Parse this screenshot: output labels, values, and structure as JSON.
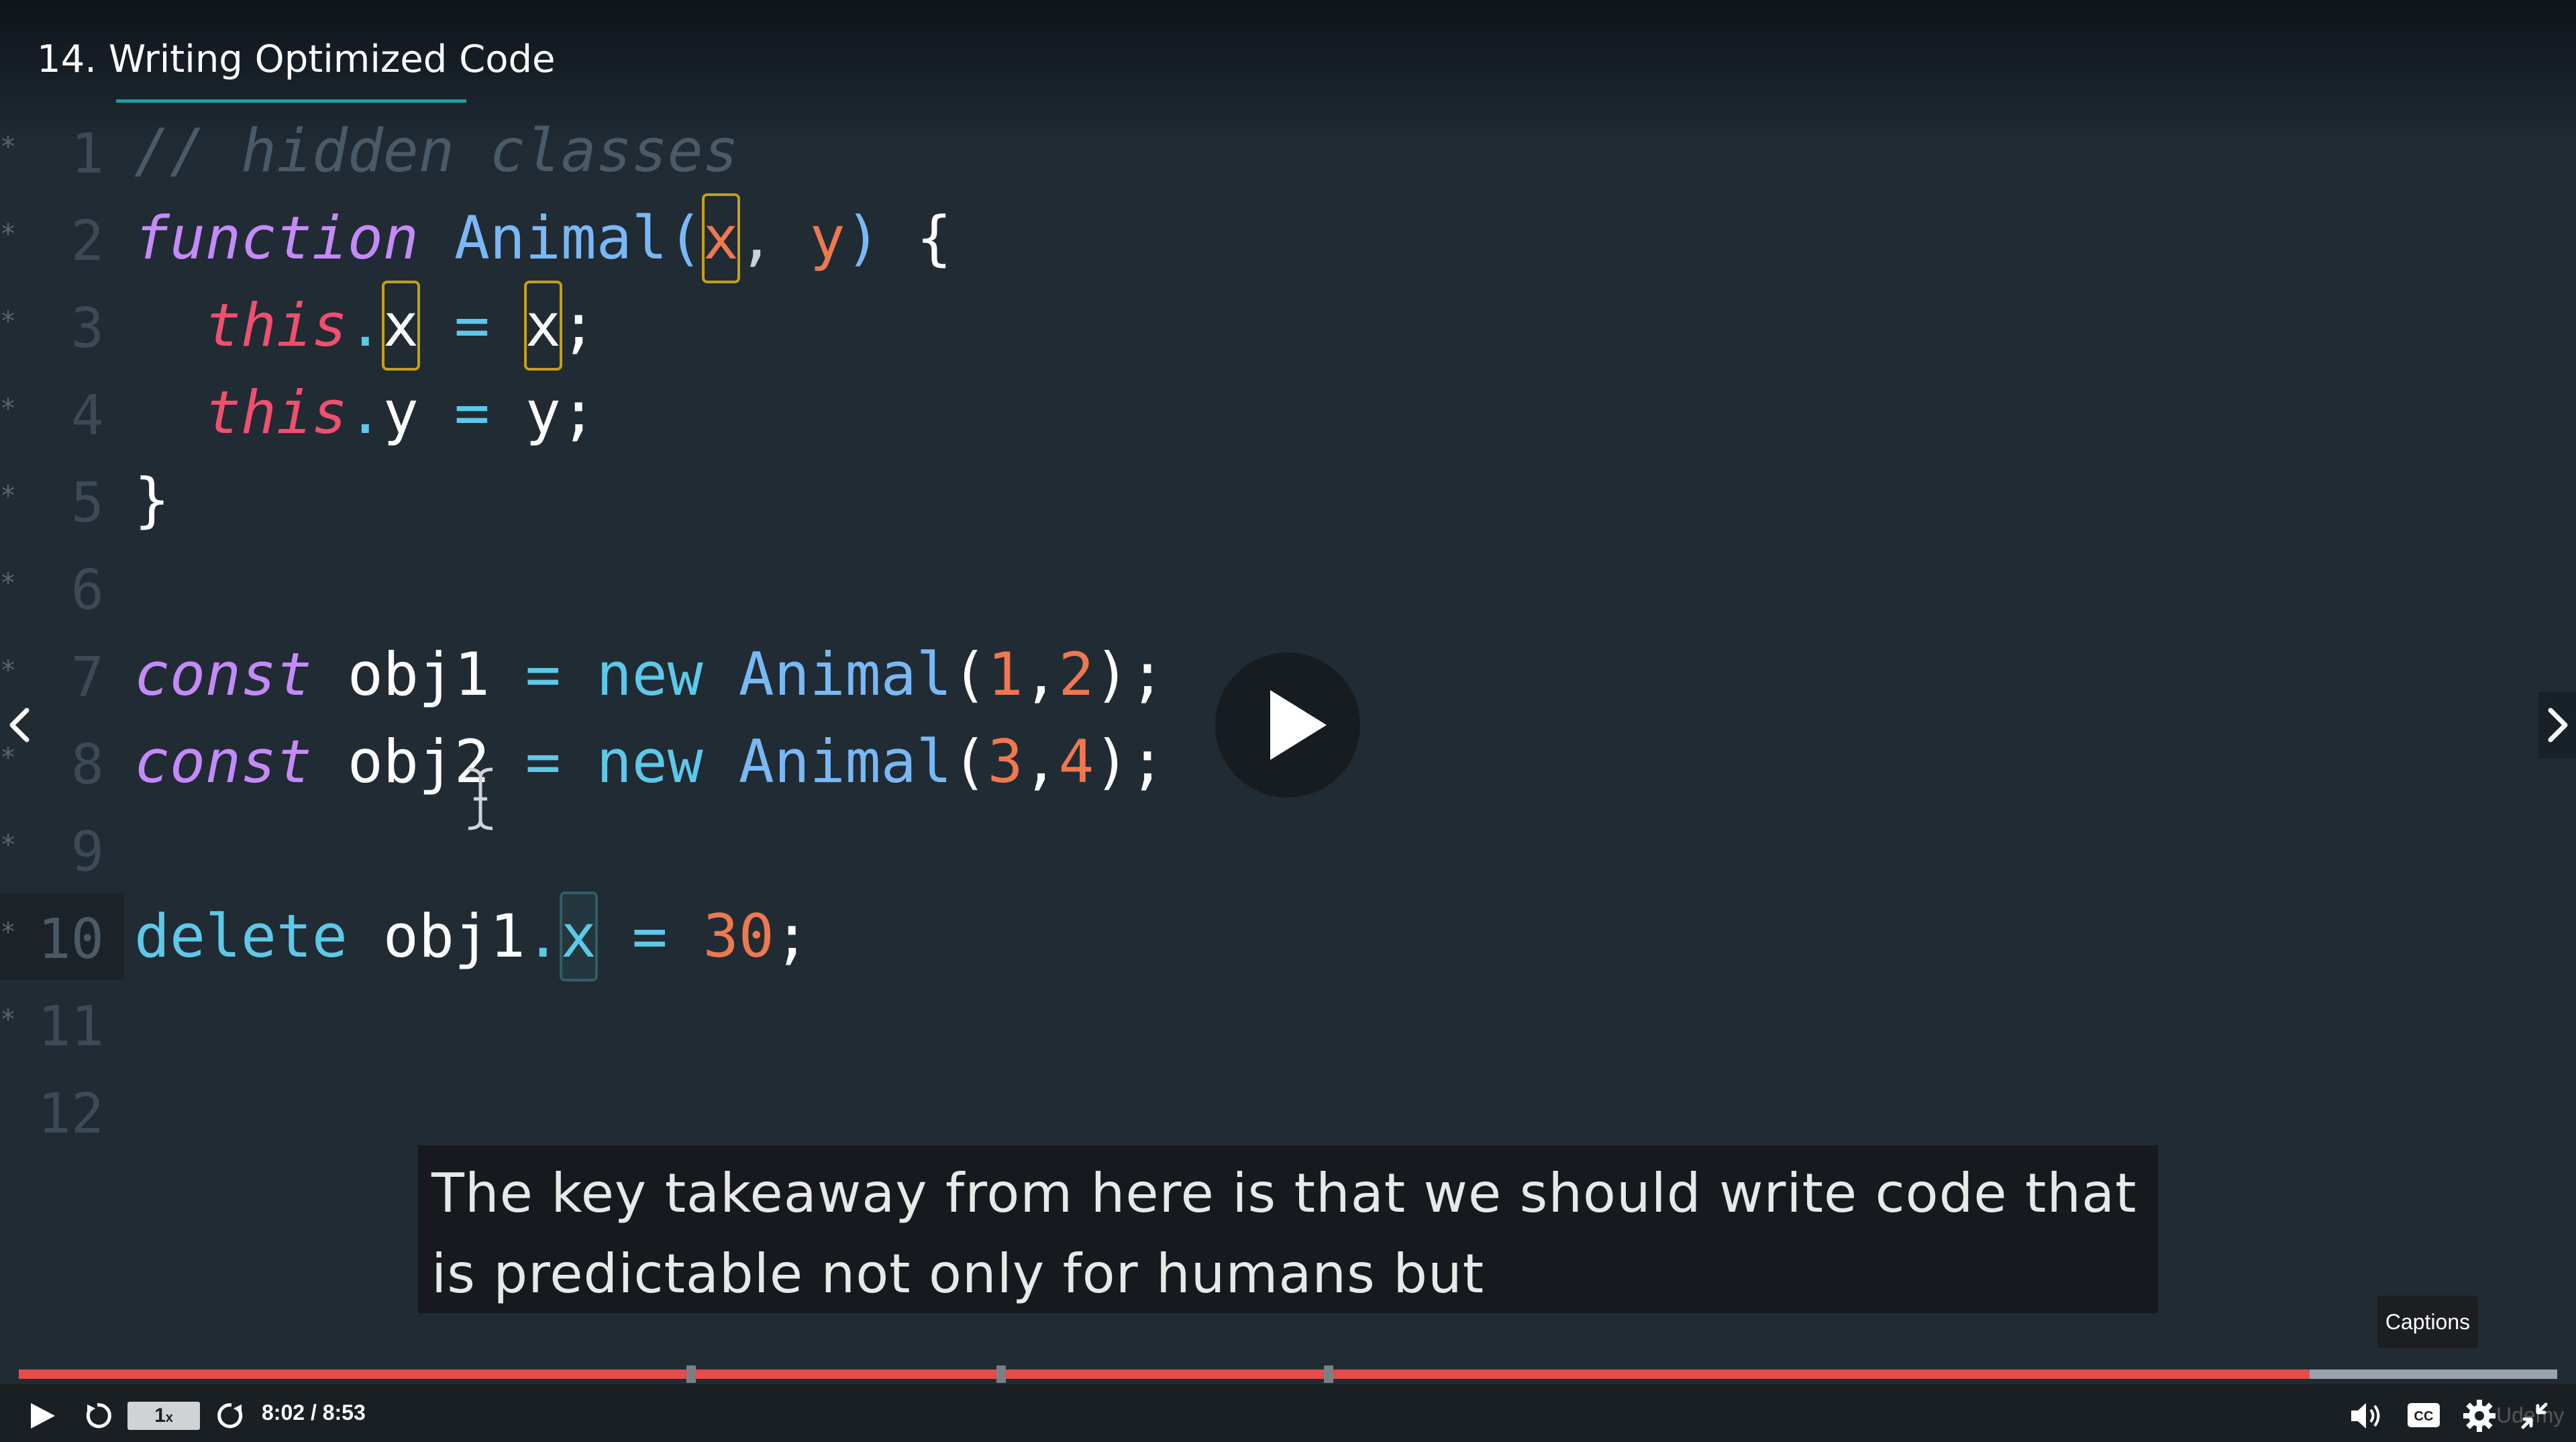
{
  "header": {
    "title": "14. Writing Optimized Code"
  },
  "editor": {
    "lines": [
      {
        "number": "1",
        "marker": "*"
      },
      {
        "number": "2",
        "marker": "*"
      },
      {
        "number": "3",
        "marker": "*"
      },
      {
        "number": "4",
        "marker": "*"
      },
      {
        "number": "5",
        "marker": "*"
      },
      {
        "number": "6",
        "marker": "*"
      },
      {
        "number": "7",
        "marker": "*"
      },
      {
        "number": "8",
        "marker": "*"
      },
      {
        "number": "9",
        "marker": "*"
      },
      {
        "number": "10",
        "marker": "*"
      },
      {
        "number": "11",
        "marker": "*"
      },
      {
        "number": "12",
        "marker": ""
      }
    ],
    "code": {
      "l1": {
        "comment": "// hidden classes"
      },
      "l2": {
        "kw": "function",
        "sp1": " ",
        "name": "Animal",
        "p1": "(",
        "a": "x",
        "comma": ", ",
        "b": "y",
        "p2": ")",
        "sp2": " ",
        "brace": "{"
      },
      "l3": {
        "indent": "  ",
        "this": "this",
        "dot": ".",
        "prop": "x",
        "eq": " = ",
        "val": "x",
        "semi": ";"
      },
      "l4": {
        "indent": "  ",
        "this": "this",
        "dot": ".",
        "prop": "y",
        "eq": " = ",
        "val": "y",
        "semi": ";"
      },
      "l5": {
        "brace": "}"
      },
      "l7": {
        "kw": "const",
        "sp": " ",
        "var": "obj1",
        "eq": " = ",
        "new": "new",
        "sp2": " ",
        "cls": "Animal",
        "p1": "(",
        "n1": "1",
        "comma": ",",
        "n2": "2",
        "p2": ")",
        "semi": ";"
      },
      "l8": {
        "kw": "const",
        "sp": " ",
        "var": "obj2",
        "eq": " = ",
        "new": "new",
        "sp2": " ",
        "cls": "Animal",
        "p1": "(",
        "n1": "3",
        "comma": ",",
        "n2": "4",
        "p2": ")",
        "semi": ";"
      },
      "l10": {
        "kw": "delete",
        "sp": " ",
        "obj": "obj1",
        "dot": ".",
        "prop": "x",
        "eq": " = ",
        "num": "30",
        "semi": ";"
      }
    }
  },
  "captions": {
    "text": "The key takeaway from here is that we should write code that is predictable not only for humans but",
    "tooltip": "Captions"
  },
  "player": {
    "progress_fraction": 0.9025,
    "chapter_fractions": [
      0.265,
      0.387,
      0.516
    ],
    "speed": "1x",
    "speed_label": "1",
    "speed_suffix": "x",
    "time": "8:02 / 8:53",
    "watermark": "Udemy"
  },
  "colors": {
    "background": "#202b34",
    "comment": "#4a5a66",
    "keyword": "#c58af9",
    "function_name": "#7ab8f5",
    "param": "#f07850",
    "this": "#f0506e",
    "operator": "#5ec8e8",
    "number": "#f07850",
    "progress": "#e44b4b"
  },
  "icons": [
    "play-icon",
    "replay-icon",
    "forward-icon",
    "volume-icon",
    "cc-icon",
    "gear-icon",
    "exit-fullscreen-icon",
    "chevron-left-icon",
    "chevron-right-icon",
    "text-cursor-icon"
  ]
}
